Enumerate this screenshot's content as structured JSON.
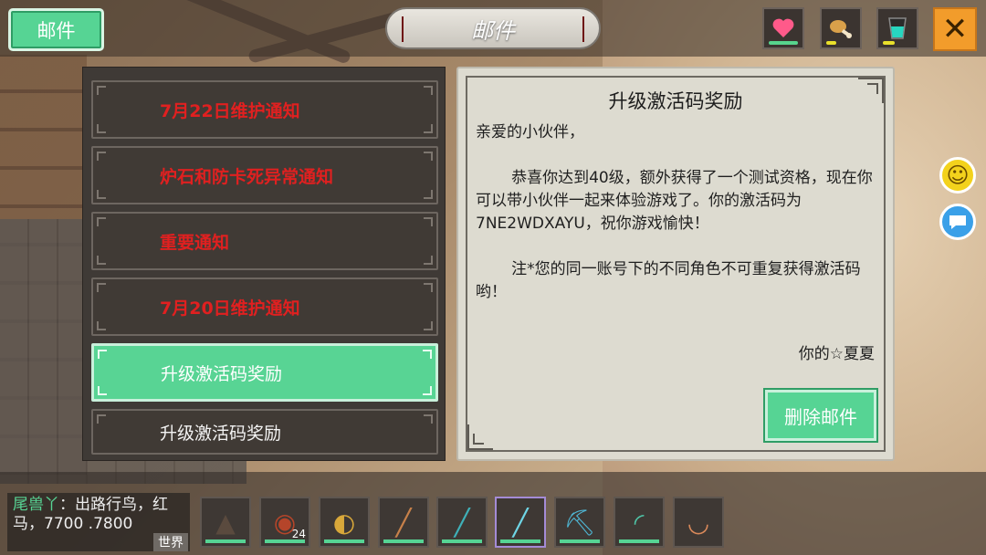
{
  "top_bar": {
    "mail_tab_label": "邮件",
    "title": "邮件",
    "stats": [
      {
        "icon": "heart-icon",
        "level": 1.0,
        "color": "#57d48d"
      },
      {
        "icon": "drumstick-icon",
        "level": 0.35,
        "color": "#e9e02b"
      },
      {
        "icon": "water-cup-icon",
        "level": 0.4,
        "color": "#e9e02b"
      }
    ],
    "close_label": "✕"
  },
  "mail_list": [
    {
      "label": "7月22日维护通知",
      "style": "red"
    },
    {
      "label": "炉石和防卡死异常通知",
      "style": "red"
    },
    {
      "label": "重要通知",
      "style": "red"
    },
    {
      "label": "7月20日维护通知",
      "style": "red"
    },
    {
      "label": "升级激活码奖励",
      "style": "selected"
    },
    {
      "label": "升级激活码奖励",
      "style": "white"
    }
  ],
  "letter": {
    "title": "升级激活码奖励",
    "greeting": "亲爱的小伙伴，",
    "paragraph1": "恭喜你达到40级，额外获得了一个测试资格，现在你可以带小伙伴一起来体验游戏了。你的激活码为7NE2WDXAYU，祝你游戏愉快！",
    "paragraph2": "注*您的同一账号下的不同角色不可重复获得激活码哟！",
    "signature": "你的☆夏夏",
    "delete_label": "删除邮件"
  },
  "side": {
    "smile_glyph": "☺",
    "chat_glyph": "●"
  },
  "chat": {
    "name": "尾兽丫",
    "message": "：出路行鸟，红马，7700 .7800",
    "world_label": "世界"
  },
  "hotbar": [
    {
      "icon": "campfire-icon",
      "glyph": "▲"
    },
    {
      "icon": "steak-icon",
      "glyph": "◉",
      "count": "24"
    },
    {
      "icon": "horn-icon",
      "glyph": "◐"
    },
    {
      "icon": "club-icon",
      "glyph": "╱"
    },
    {
      "icon": "spear-icon",
      "glyph": "╱"
    },
    {
      "icon": "crystal-sword-icon",
      "glyph": "╱"
    },
    {
      "icon": "pickaxe-icon",
      "glyph": "⛏"
    },
    {
      "icon": "bow-icon",
      "glyph": "◜"
    },
    {
      "icon": "boat-icon",
      "glyph": "◡"
    }
  ]
}
